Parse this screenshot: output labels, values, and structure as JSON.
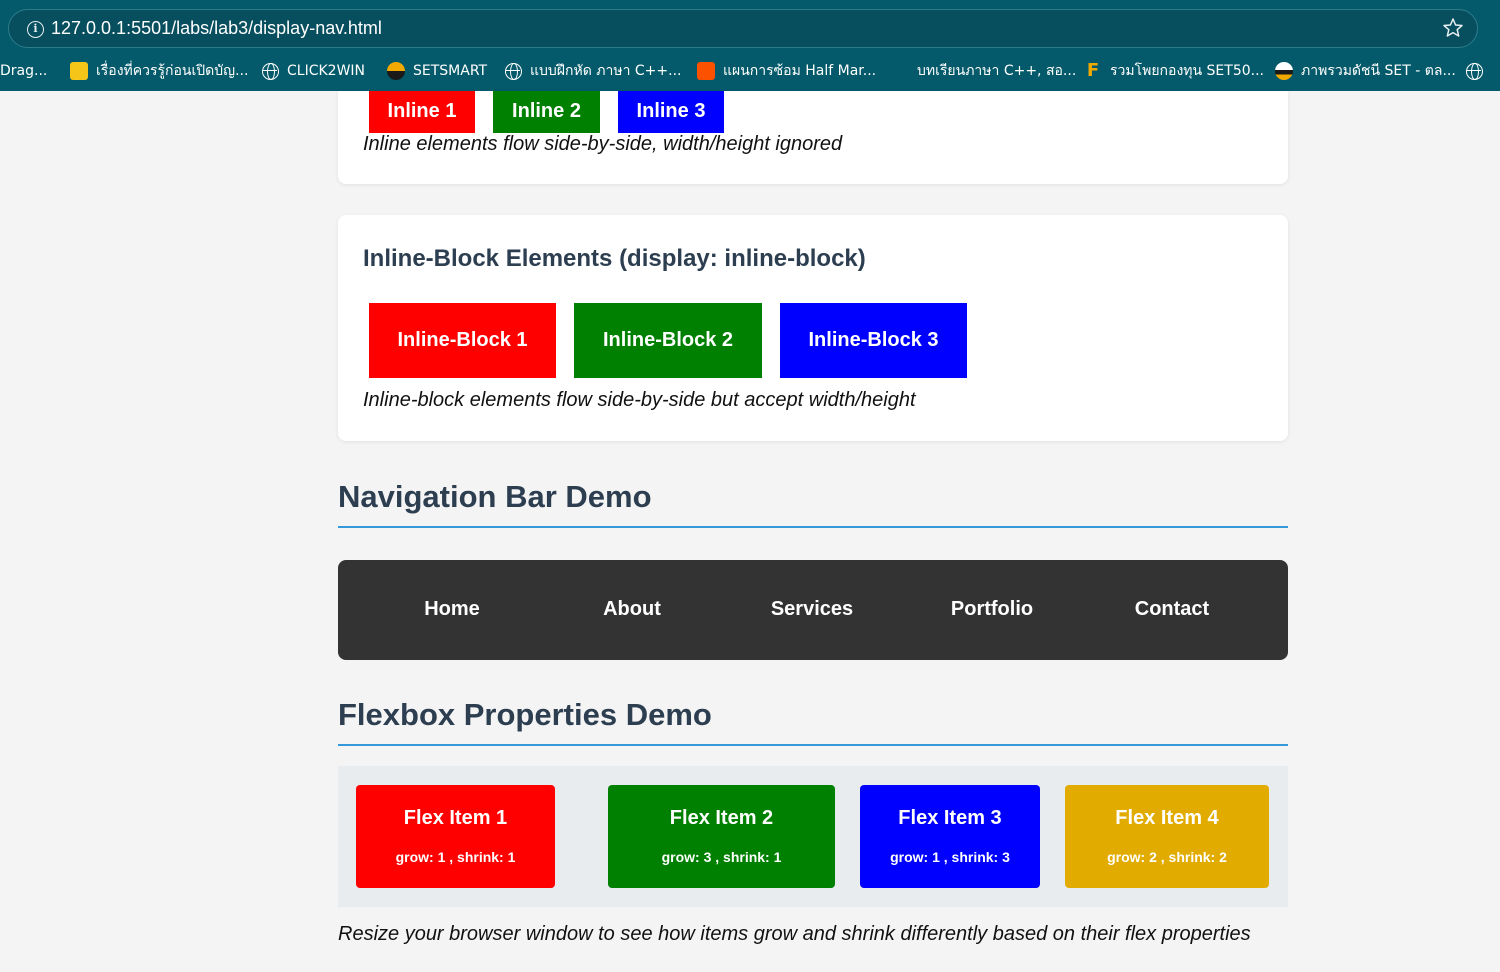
{
  "browser": {
    "url": "127.0.0.1:5501/labs/lab3/display-nav.html",
    "bookmarks": [
      {
        "label": "Drag...",
        "icon": "none"
      },
      {
        "label": "เรื่องที่ควรรู้ก่อนเปิดบัญ...",
        "icon": "bank-icon"
      },
      {
        "label": "CLICK2WIN",
        "icon": "globe-icon"
      },
      {
        "label": "SETSMART",
        "icon": "setsmart-icon"
      },
      {
        "label": "แบบฝึกหัด ภาษา C++...",
        "icon": "globe-icon"
      },
      {
        "label": "แผนการซ้อม Half Mar...",
        "icon": "strava-icon"
      },
      {
        "label": "บทเรียนภาษา C++, สอ...",
        "icon": "none"
      },
      {
        "label": "รวมโพยกองทุน SET50...",
        "icon": "f-icon"
      },
      {
        "label": "ภาพรวมดัชนี SET - ตล...",
        "icon": "set-icon"
      },
      {
        "label": "",
        "icon": "globe-icon"
      }
    ]
  },
  "inline_section": {
    "boxes": [
      "Inline 1",
      "Inline 2",
      "Inline 3"
    ],
    "note": "Inline elements flow side-by-side, width/height ignored"
  },
  "inline_block_section": {
    "title": "Inline-Block Elements (display: inline-block)",
    "boxes": [
      "Inline-Block 1",
      "Inline-Block 2",
      "Inline-Block 3"
    ],
    "note": "Inline-block elements flow side-by-side but accept width/height"
  },
  "nav_section": {
    "title": "Navigation Bar Demo",
    "links": [
      "Home",
      "About",
      "Services",
      "Portfolio",
      "Contact"
    ]
  },
  "flex_section": {
    "title": "Flexbox Properties Demo",
    "items": [
      {
        "title": "Flex Item 1",
        "props": "grow: 1 , shrink: 1"
      },
      {
        "title": "Flex Item 2",
        "props": "grow: 3 , shrink: 1"
      },
      {
        "title": "Flex Item 3",
        "props": "grow: 1 , shrink: 3"
      },
      {
        "title": "Flex Item 4",
        "props": "grow: 2 , shrink: 2"
      }
    ],
    "note": "Resize your browser window to see how items grow and shrink differently based on their flex properties"
  },
  "colors": {
    "red": "#ff0000",
    "green": "#008000",
    "blue": "#0000ff",
    "gold": "#e2ab00",
    "nav_bg": "#333333",
    "heading": "#2c3e50",
    "rule": "#3498db"
  }
}
